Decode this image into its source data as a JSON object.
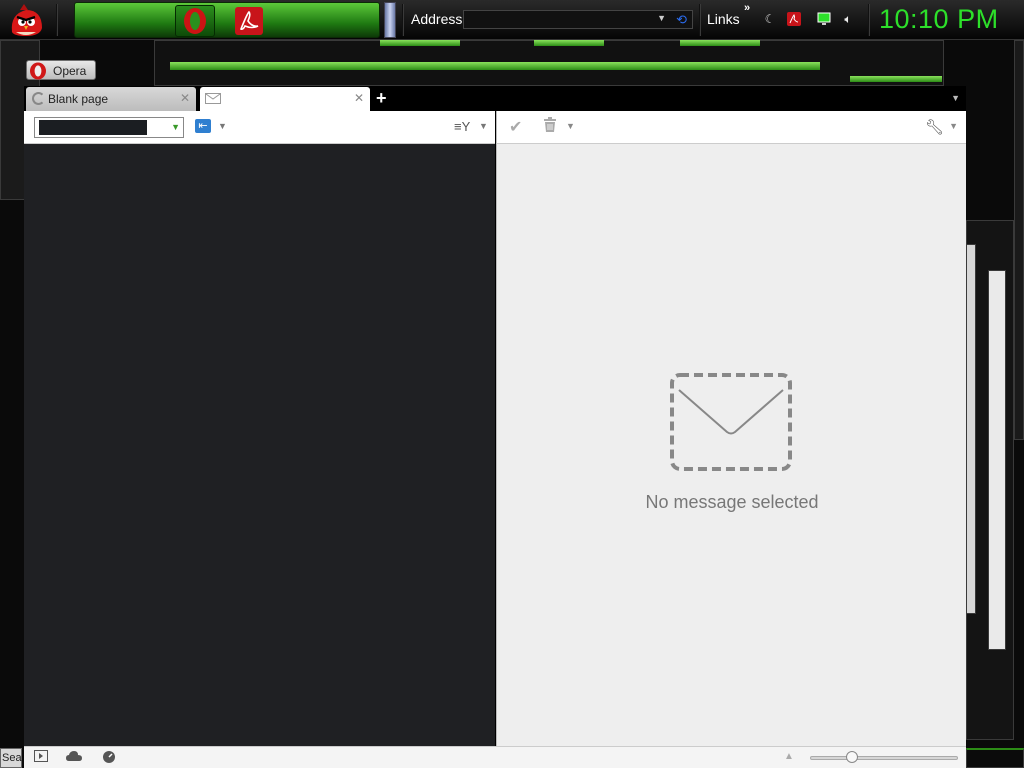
{
  "taskbar": {
    "address_label": "Address",
    "links_label": "Links",
    "links_chevron": "»",
    "clock": "10:10 PM"
  },
  "opera": {
    "menu_button_label": "Opera",
    "tabs": [
      {
        "label": "Blank page",
        "state": "loading"
      },
      {
        "label": "",
        "icon": "mail-icon",
        "active": true
      }
    ]
  },
  "mail": {
    "empty_message": "No message selected"
  },
  "desktop": {
    "search_stub": "Sea"
  },
  "colors": {
    "clock_green": "#2de02a",
    "list_pane_bg": "#1f2023",
    "message_pane_bg": "#eeeeee",
    "compose_blue": "#2f7fd0"
  }
}
